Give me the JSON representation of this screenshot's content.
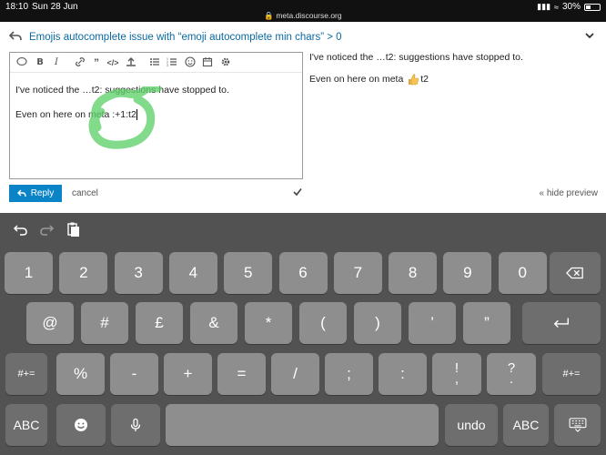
{
  "status_bar": {
    "time": "18:10",
    "date": "Sun 28 Jun",
    "url": "meta.discourse.org",
    "battery_label": "30%",
    "battery_level": 0.3
  },
  "composer": {
    "topic_title": "Emojis autocomplete issue with “emoji autocomplete min chars” > 0",
    "editor_lines": [
      "I've noticed the …t2: suggestions have stopped to.",
      "Even on here on meta :+1:t2"
    ],
    "preview": {
      "line1": "I've noticed the …t2: suggestions have stopped to.",
      "line2_before": "Even on here on meta ",
      "line2_after": "t2",
      "emoji_icon": "thumbs-up-emoji"
    },
    "reply_label": "Reply",
    "cancel_label": "cancel",
    "hide_preview_label": "« hide preview"
  },
  "colors": {
    "link_blue": "#0a6aa1",
    "reply_button": "#0a84c6",
    "annotation_green": "#5fd06a",
    "keyboard_bg": "#525252",
    "key_light": "#8e8e8e",
    "key_dark": "#6e6e6e"
  },
  "keyboard": {
    "row1": [
      "1",
      "2",
      "3",
      "4",
      "5",
      "6",
      "7",
      "8",
      "9",
      "0"
    ],
    "row2": [
      "@",
      "#",
      "£",
      "&",
      "*",
      "(",
      ")",
      "’",
      "”"
    ],
    "row3_left": "#+=",
    "row3": [
      "%",
      "-",
      "+",
      "=",
      "/",
      ";",
      ":"
    ],
    "row3_excl": [
      "!",
      ","
    ],
    "row3_quest": [
      "?",
      "."
    ],
    "row3_right": "#+=",
    "row4_abc_left": "ABC",
    "row4_undo": "undo",
    "row4_abc_right": "ABC",
    "icons": {
      "backspace": "backspace-icon",
      "return": "return-icon",
      "emoji": "emoji-icon",
      "mic": "microphone-icon",
      "dismiss": "keyboard-dismiss-icon",
      "undo": "undo-arrow-icon",
      "redo": "redo-arrow-icon",
      "paste": "paste-icon"
    }
  }
}
